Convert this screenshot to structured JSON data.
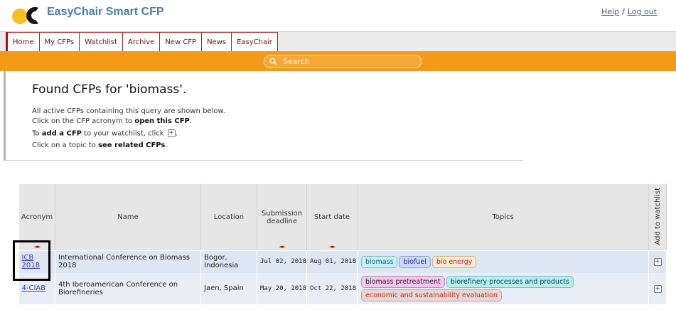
{
  "header": {
    "title": "EasyChair Smart CFP",
    "help_label": "Help",
    "separator": "/",
    "logout_label": "Log out"
  },
  "nav": {
    "tabs": [
      {
        "label": "Home"
      },
      {
        "label": "My CFPs"
      },
      {
        "label": "Watchlist"
      },
      {
        "label": "Archive"
      },
      {
        "label": "New CFP"
      },
      {
        "label": "News"
      },
      {
        "label": "EasyChair"
      }
    ]
  },
  "search": {
    "placeholder": "Search"
  },
  "info": {
    "heading": "Found CFPs for 'biomass'.",
    "line1": "All active CFPs containing this query are shown below.",
    "line2_pre": "Click on the CFP acronym to ",
    "line2_bold": "open this CFP",
    "line2_post": ".",
    "line3_pre": "To ",
    "line3_bold": "add a CFP",
    "line3_mid": " to your watchlist, click ",
    "line3_icon": "+",
    "line3_post": ".",
    "line4_pre": "Click on a topic to ",
    "line4_bold": "see related CFPs",
    "line4_post": "."
  },
  "table": {
    "headers": {
      "acronym": "Acronym",
      "name": "Name",
      "location": "Location",
      "deadline": "Submission deadline",
      "start": "Start date",
      "topics": "Topics",
      "add": "Add to watchlist"
    },
    "sort_symbol": "◄►",
    "add_symbol": "+",
    "rows": [
      {
        "acronym": "ICB 2018",
        "name": "International Conference on Biomass 2018",
        "location": "Bogor, Indonesia",
        "deadline": "Jul 02, 2018",
        "start": "Aug 01, 2018",
        "topics": [
          {
            "label": "biomass",
            "bg": "#c4f3f7",
            "fg": "#1b5a7a",
            "border": "#8fb6c0"
          },
          {
            "label": "biofuel",
            "bg": "#cdd9f7",
            "fg": "#1a2aa0",
            "border": "#8da0c8"
          },
          {
            "label": "bio energy",
            "bg": "#f9eacb",
            "fg": "#c2185b",
            "border": "#c9b58a"
          }
        ]
      },
      {
        "acronym": "4-CIAB",
        "name": "4th Iberoamerican Conference on Biorefineries",
        "location": "Jaen, Spain",
        "deadline": "May 20, 2018",
        "start": "Oct 22, 2018",
        "topics": [
          {
            "label": "biomass pretreatment",
            "bg": "#f8c6ee",
            "fg": "#222222",
            "border": "#b98ab0"
          },
          {
            "label": "biorefinery processes and products",
            "bg": "#b6f0ef",
            "fg": "#123c5c",
            "border": "#7bbcbb"
          },
          {
            "label": "economic and sustainability evaluation",
            "bg": "#e7d7d7",
            "fg": "#c0281c",
            "border": "#b9a3a3"
          }
        ]
      }
    ]
  }
}
